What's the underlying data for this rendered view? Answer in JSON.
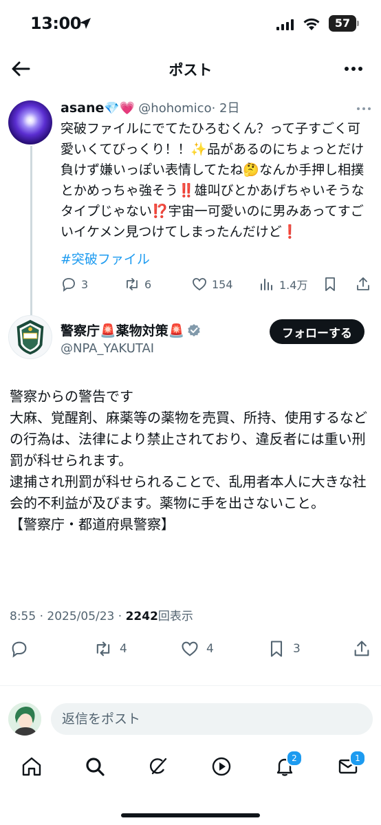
{
  "status_bar": {
    "time": "13:00",
    "battery": "57"
  },
  "header": {
    "title": "ポスト"
  },
  "parent_tweet": {
    "name": "asane",
    "name_emojis": "💎💗",
    "handle": "@hohomico",
    "age": "· 2日",
    "text": "突破ファイルにでてたひろむくん？って子すごく可愛いくてびっくり！！✨品があるのにちょっとだけ負けず嫌いっぽい表情してたね🤔なんか手押し相撲とかめっちゃ強そう‼️雄叫びとかあげちゃいそうなタイプじゃない⁉️宇宙一可愛いのに男みあってすごいイケメン見つけてしまったんだけど❗️",
    "hashtag": "#突破ファイル",
    "stats": {
      "replies": "3",
      "reposts": "6",
      "likes": "154",
      "views": "1.4万"
    }
  },
  "main_tweet": {
    "name": "警察庁🚨薬物対策🚨",
    "handle": "@NPA_YAKUTAI",
    "follow_label": "フォローする",
    "text": "警察からの警告です\n大麻、覚醒剤、麻薬等の薬物を売買、所持、使用するなどの行為は、法律により禁止されており、違反者には重い刑罰が科せられます。\n逮捕され刑罰が科せられることで、乱用者本人に大きな社会的不利益が及びます。薬物に手を出さないこと。\n【警察庁・都道府県警察】",
    "time": "8:55 · 2025/05/23 · ",
    "view_count": "2242",
    "view_label": "回表示",
    "stats": {
      "replies": "",
      "reposts": "4",
      "likes": "4",
      "bookmarks": "3"
    }
  },
  "reply": {
    "placeholder": "返信をポスト"
  },
  "tabbar": {
    "notifications_badge": "2",
    "messages_badge": "1"
  },
  "colors": {
    "accent": "#1d9bf0",
    "text": "#0f1419",
    "muted": "#536471"
  }
}
